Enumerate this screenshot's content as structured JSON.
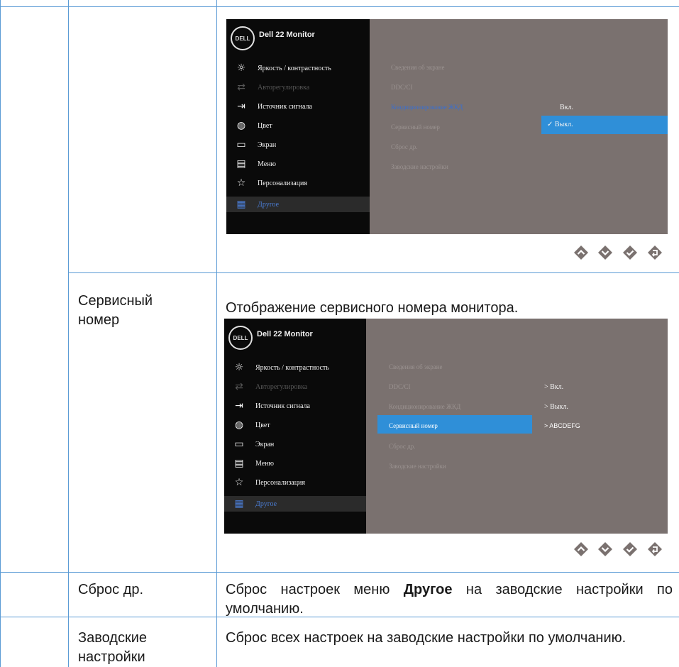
{
  "rows": {
    "service_tag": {
      "label": "Сервисный номер",
      "description": "Отображение сервисного номера монитора."
    },
    "reset_other": {
      "label": "Сброс др.",
      "description_prefix": "Сброс настроек меню ",
      "description_bold": "Другое",
      "description_suffix": " на заводские настройки по умолчанию."
    },
    "factory_reset": {
      "label": "Заводские настройки",
      "description": "Сброс всех настроек на заводские настройки по умолчанию."
    }
  },
  "osd": {
    "logo": "DELL",
    "model": "Dell 22 Monitor",
    "menu": [
      {
        "icon": "brightness-icon",
        "glyph": "☼",
        "label": "Яркость / контрастность"
      },
      {
        "icon": "auto-adjust-icon",
        "glyph": "⇄",
        "label": "Авторегулировка"
      },
      {
        "icon": "input-source-icon",
        "glyph": "⇥",
        "label": "Источник сигнала"
      },
      {
        "icon": "color-icon",
        "glyph": "◍",
        "label": "Цвет"
      },
      {
        "icon": "display-icon",
        "glyph": "▭",
        "label": "Экран"
      },
      {
        "icon": "menu-icon",
        "glyph": "▤",
        "label": "Меню"
      },
      {
        "icon": "star-icon",
        "glyph": "☆",
        "label": "Персонализация"
      },
      {
        "icon": "other-icon",
        "glyph": "▦",
        "label": "Другое"
      }
    ],
    "submenu": [
      "Сведения об экране",
      "DDC/CI",
      "Кондиционирование ЖКД",
      "Сервисный номер",
      "Сброс др.",
      "Заводские настройки"
    ],
    "screen1_values": {
      "on": "Вкл.",
      "off": "✓ Выкл."
    },
    "screen2_values": {
      "ddc": "> Вкл.",
      "lcd": "> Выкл.",
      "tag": "> ABCDEFG"
    }
  },
  "buttons": [
    "up-icon",
    "down-icon",
    "check-icon",
    "back-icon"
  ],
  "colors": {
    "accent": "#2f8fd8",
    "button": "#7a716f",
    "table_line": "#5b9bd5"
  }
}
